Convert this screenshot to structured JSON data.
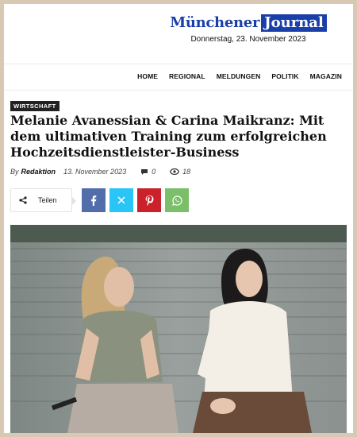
{
  "site": {
    "logo_left": "Münchener",
    "logo_right": "Journal",
    "date": "Donnerstag, 23. November 2023"
  },
  "nav": {
    "items": [
      "HOME",
      "REGIONAL",
      "MELDUNGEN",
      "POLITIK",
      "MAGAZIN"
    ]
  },
  "article": {
    "category": "WIRTSCHAFT",
    "title": "Melanie Avanessian & Carina Maikranz: Mit dem ultimativen Training zum erfolgreichen Hochzeitsdienstleister-Business",
    "by": "By",
    "author": "Redaktion",
    "date": "13. November 2023",
    "comments": "0",
    "views": "18"
  },
  "share": {
    "label": "Teilen",
    "buttons": [
      "facebook-icon",
      "x-icon",
      "pinterest-icon",
      "whatsapp-icon"
    ]
  },
  "colors": {
    "brand": "#1b3fa8",
    "facebook": "#516eab",
    "x": "#29c5f6",
    "pinterest": "#ca212a",
    "whatsapp": "#7bbf6a"
  }
}
